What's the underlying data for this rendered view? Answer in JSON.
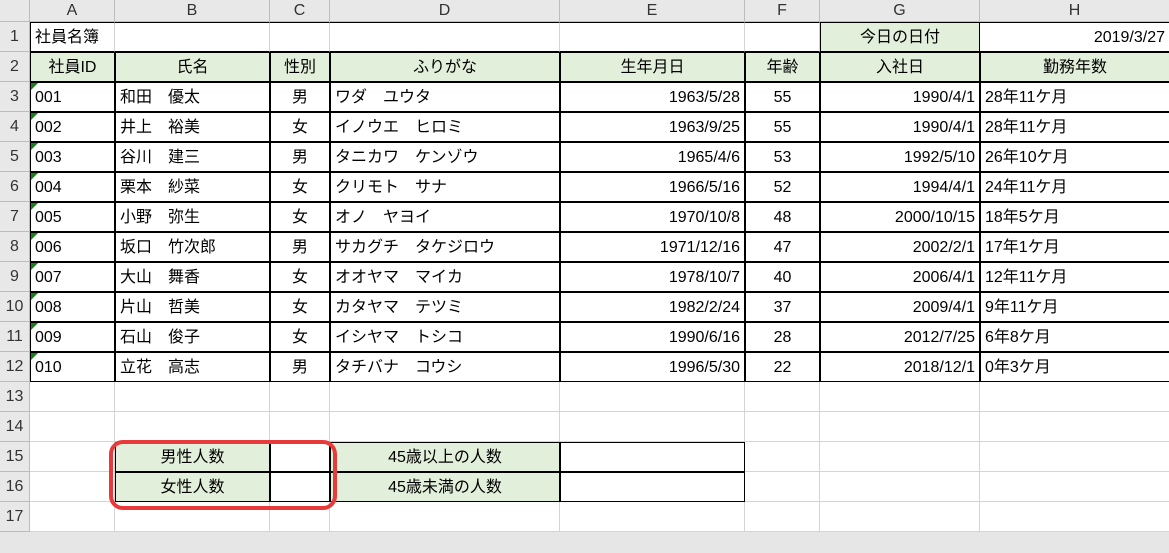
{
  "columns": [
    "A",
    "B",
    "C",
    "D",
    "E",
    "F",
    "G",
    "H"
  ],
  "row_numbers": [
    1,
    2,
    3,
    4,
    5,
    6,
    7,
    8,
    9,
    10,
    11,
    12,
    13,
    14,
    15,
    16,
    17
  ],
  "title": "社員名簿",
  "today_label": "今日の日付",
  "today_value": "2019/3/27",
  "headers": {
    "id": "社員ID",
    "name": "氏名",
    "sex": "性別",
    "kana": "ふりがな",
    "birth": "生年月日",
    "age": "年齢",
    "hire": "入社日",
    "tenure": "勤務年数"
  },
  "rows": [
    {
      "id": "001",
      "name": "和田　優太",
      "sex": "男",
      "kana": "ワダ　ユウタ",
      "birth": "1963/5/28",
      "age": "55",
      "hire": "1990/4/1",
      "tenure": "28年11ケ月"
    },
    {
      "id": "002",
      "name": "井上　裕美",
      "sex": "女",
      "kana": "イノウエ　ヒロミ",
      "birth": "1963/9/25",
      "age": "55",
      "hire": "1990/4/1",
      "tenure": "28年11ケ月"
    },
    {
      "id": "003",
      "name": "谷川　建三",
      "sex": "男",
      "kana": "タニカワ　ケンゾウ",
      "birth": "1965/4/6",
      "age": "53",
      "hire": "1992/5/10",
      "tenure": "26年10ケ月"
    },
    {
      "id": "004",
      "name": "栗本　紗菜",
      "sex": "女",
      "kana": "クリモト　サナ",
      "birth": "1966/5/16",
      "age": "52",
      "hire": "1994/4/1",
      "tenure": "24年11ケ月"
    },
    {
      "id": "005",
      "name": "小野　弥生",
      "sex": "女",
      "kana": "オノ　ヤヨイ",
      "birth": "1970/10/8",
      "age": "48",
      "hire": "2000/10/15",
      "tenure": "18年5ケ月"
    },
    {
      "id": "006",
      "name": "坂口　竹次郎",
      "sex": "男",
      "kana": "サカグチ　タケジロウ",
      "birth": "1971/12/16",
      "age": "47",
      "hire": "2002/2/1",
      "tenure": "17年1ケ月"
    },
    {
      "id": "007",
      "name": "大山　舞香",
      "sex": "女",
      "kana": "オオヤマ　マイカ",
      "birth": "1978/10/7",
      "age": "40",
      "hire": "2006/4/1",
      "tenure": "12年11ケ月"
    },
    {
      "id": "008",
      "name": "片山　哲美",
      "sex": "女",
      "kana": "カタヤマ　テツミ",
      "birth": "1982/2/24",
      "age": "37",
      "hire": "2009/4/1",
      "tenure": "9年11ケ月"
    },
    {
      "id": "009",
      "name": "石山　俊子",
      "sex": "女",
      "kana": "イシヤマ　トシコ",
      "birth": "1990/6/16",
      "age": "28",
      "hire": "2012/7/25",
      "tenure": "6年8ケ月"
    },
    {
      "id": "010",
      "name": "立花　高志",
      "sex": "男",
      "kana": "タチバナ　コウシ",
      "birth": "1996/5/30",
      "age": "22",
      "hire": "2018/12/1",
      "tenure": "0年3ケ月"
    }
  ],
  "summary": {
    "male_count_label": "男性人数",
    "female_count_label": "女性人数",
    "over45_label": "45歳以上の人数",
    "under45_label": "45歳未満の人数"
  }
}
